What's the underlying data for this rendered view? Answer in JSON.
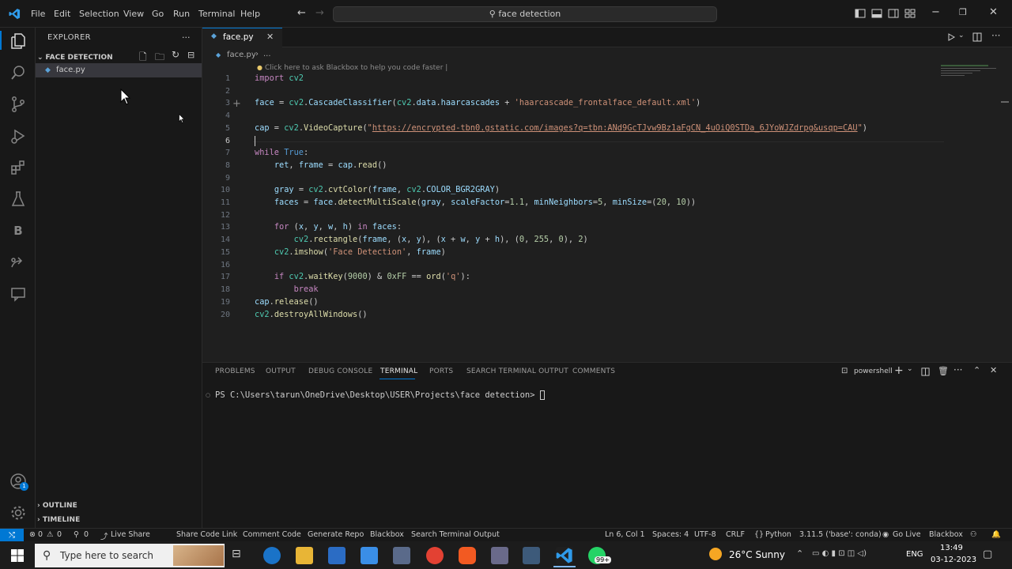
{
  "titlebar": {
    "menu": [
      "File",
      "Edit",
      "Selection",
      "View",
      "Go",
      "Run",
      "Terminal",
      "Help"
    ],
    "command_center": "face detection"
  },
  "sidebar": {
    "title": "EXPLORER",
    "more": "...",
    "folder": "FACE DETECTION",
    "files": [
      "face.py"
    ],
    "outline": "OUTLINE",
    "timeline": "TIMELINE"
  },
  "editor": {
    "tab": "face.py",
    "breadcrumb_file": "face.py",
    "breadcrumb_more": "...",
    "hint": "Click here to ask Blackbox to help you code faster |",
    "line_numbers": [
      "1",
      "2",
      "3",
      "4",
      "5",
      "6",
      "7",
      "8",
      "9",
      "10",
      "11",
      "12",
      "13",
      "14",
      "15",
      "16",
      "17",
      "18",
      "19",
      "20"
    ]
  },
  "panel": {
    "tabs": [
      "PROBLEMS",
      "OUTPUT",
      "DEBUG CONSOLE",
      "TERMINAL",
      "PORTS",
      "SEARCH TERMINAL OUTPUT",
      "COMMENTS"
    ],
    "active_tab": "TERMINAL",
    "shell": "powershell",
    "prompt": "PS C:\\Users\\tarun\\OneDrive\\Desktop\\USER\\Projects\\face detection>"
  },
  "statusbar": {
    "errors": "0",
    "warnings": "0",
    "ports": "0",
    "items_left": [
      "Live Share",
      "Share Code Link",
      "Comment Code",
      "Generate Repo",
      "Blackbox",
      "Search Terminal Output"
    ],
    "position": "Ln 6, Col 1",
    "spaces": "Spaces: 4",
    "encoding": "UTF-8",
    "eol": "CRLF",
    "language": "Python",
    "interpreter": "3.11.5 ('base': conda)",
    "golive": "Go Live",
    "blackbox": "Blackbox"
  },
  "taskbar": {
    "search_placeholder": "Type here to search",
    "weather": "26°C  Sunny",
    "lang": "ENG",
    "time": "13:49",
    "date": "03-12-2023",
    "badge": "99+"
  },
  "colors": {
    "accent": "#0078d4",
    "status_remote": "#0078d4",
    "keyword": "#c586c0",
    "function": "#dcdcaa",
    "string": "#ce9178"
  }
}
